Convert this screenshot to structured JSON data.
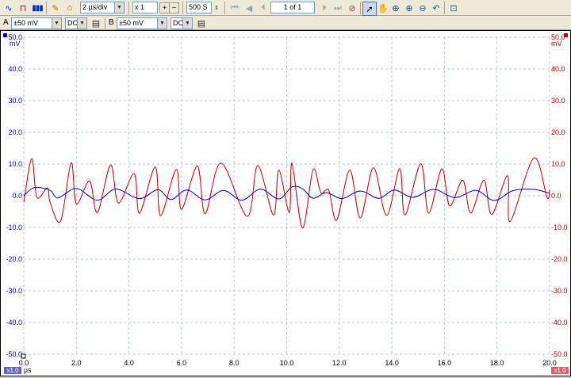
{
  "toolbar": {
    "timebase": "2 µs/div",
    "zoom": "x 1",
    "samples": "500 S",
    "page_indicator": "1 of 1",
    "icons": [
      "scope-mode-icon",
      "persistence-mode-icon",
      "spectrum-mode-icon",
      "probe-icon",
      "home-icon",
      "zoom-plus-icon",
      "zoom-minus-icon",
      "samples-spinner-icon",
      "first-page-icon",
      "prev-page-icon",
      "next-page-icon",
      "last-page-icon",
      "stop-icon",
      "pointer-icon",
      "hand-icon",
      "zoom-in-icon",
      "zoom-in-alt-icon",
      "zoom-out-icon",
      "undo-zoom-icon",
      "zoom-fit-icon"
    ]
  },
  "channels": {
    "a": {
      "label": "A",
      "range": "±50 mV",
      "coupling": "DC",
      "color": "#0000c0"
    },
    "b": {
      "label": "B",
      "range": "±50 mV",
      "coupling": "DC",
      "color": "#c00000"
    }
  },
  "scope": {
    "left_unit": "mV",
    "right_unit": "mV",
    "x_unit": "µs",
    "left_scale_badge": "x1.0",
    "right_scale_badge": "x1.0"
  },
  "chart_data": {
    "type": "line",
    "xlim": [
      0.0,
      20.0
    ],
    "ylim": [
      -50.0,
      50.0
    ],
    "x_ticks": [
      "0.0",
      "2.0",
      "4.0",
      "6.0",
      "8.0",
      "10.0",
      "12.0",
      "14.0",
      "16.0",
      "18.0",
      "20.0"
    ],
    "y_ticks": [
      "50.0",
      "40.0",
      "30.0",
      "20.0",
      "10.0",
      "0.0",
      "-10.0",
      "-20.0",
      "-30.0",
      "-40.0",
      "-50.0"
    ],
    "grid": true,
    "series": [
      {
        "channel": "B",
        "color": "#c00000",
        "x": [
          0.0,
          0.3,
          0.5,
          0.9,
          1.0,
          1.4,
          1.8,
          2.0,
          2.5,
          2.8,
          3.3,
          3.6,
          4.2,
          4.4,
          5.0,
          5.2,
          5.8,
          6.0,
          6.6,
          6.9,
          7.5,
          8.5,
          8.9,
          9.5,
          9.7,
          10.1,
          10.2,
          10.6,
          11.0,
          11.3,
          11.6,
          11.9,
          12.4,
          12.8,
          13.3,
          13.8,
          14.3,
          14.5,
          15.1,
          15.4,
          15.9,
          16.2,
          16.7,
          17.0,
          17.5,
          17.8,
          18.4,
          18.5,
          19.4,
          19.9,
          20.0
        ],
        "values": [
          -2.0,
          11.7,
          -0.5,
          2.5,
          -2.0,
          -8.0,
          10.4,
          -2.5,
          4.6,
          -5.3,
          9.7,
          -2.3,
          7.0,
          -5.5,
          9.1,
          -6.3,
          8.3,
          -4.3,
          9.3,
          -5.7,
          10.3,
          -6.5,
          9.5,
          -6.1,
          8.1,
          -5.3,
          10.3,
          -10.2,
          8.2,
          1.0,
          1.7,
          -7.7,
          8.1,
          -7.0,
          8.8,
          -6.2,
          8.6,
          -6.1,
          10.1,
          -5.5,
          8.5,
          -3.2,
          4.9,
          -5.5,
          4.9,
          -5.9,
          6.3,
          -8.1,
          11.9,
          -0.5,
          2.0
        ]
      },
      {
        "channel": "A",
        "color": "#0000c0",
        "x": [
          0.0,
          0.4,
          1.0,
          1.3,
          2.0,
          2.8,
          3.5,
          4.4,
          5.1,
          5.6,
          6.2,
          6.9,
          7.6,
          8.3,
          9.0,
          9.7,
          10.2,
          10.6,
          11.0,
          11.5,
          12.1,
          12.8,
          13.5,
          14.1,
          14.8,
          15.6,
          16.4,
          17.2,
          17.9,
          18.6,
          19.4,
          20.0
        ],
        "values": [
          0.0,
          2.6,
          1.7,
          -0.7,
          2.3,
          -1.4,
          2.1,
          -0.9,
          1.9,
          -1.2,
          1.8,
          -1.3,
          1.7,
          -1.4,
          2.1,
          -1.0,
          2.8,
          2.2,
          -0.8,
          1.0,
          -0.9,
          1.5,
          -0.8,
          1.8,
          -0.5,
          2.0,
          -0.6,
          1.7,
          -1.5,
          1.6,
          2.0,
          0.8
        ]
      }
    ]
  }
}
